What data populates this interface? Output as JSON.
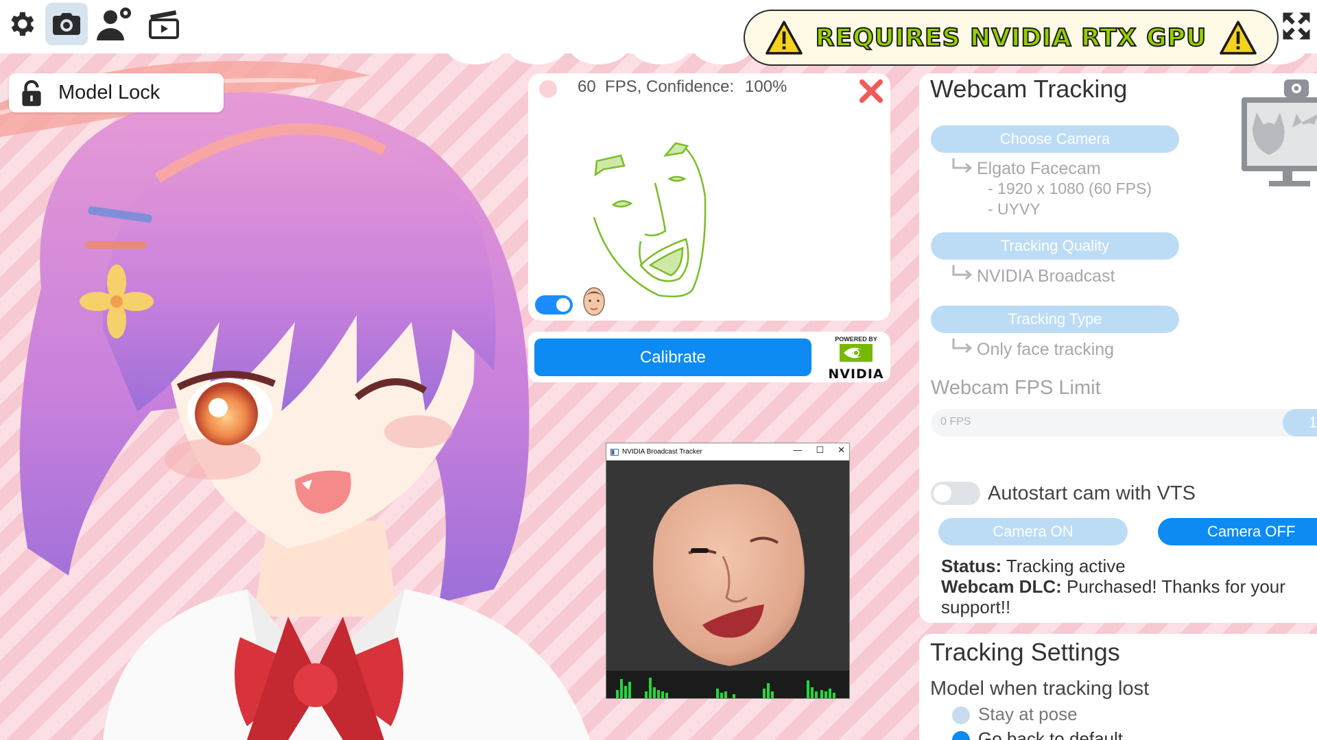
{
  "toolbar": {
    "items": [
      {
        "icon": "gear-icon"
      },
      {
        "icon": "camera-icon",
        "active": true
      },
      {
        "icon": "user-settings-icon"
      },
      {
        "icon": "clapperboard-icon"
      }
    ]
  },
  "banner": {
    "text": "REQUIRES NVIDIA RTX GPU",
    "icon": "warning-icon",
    "text_color": "#95d000",
    "icon_color": "#f5d21b"
  },
  "model_lock": {
    "label": "Model Lock",
    "icon": "lock-icon"
  },
  "face_preview": {
    "fps_text": "60  FPS, Confidence:",
    "confidence": "100%",
    "line_color": "#7cbe2c",
    "toggle_on": true
  },
  "calibrate": {
    "label": "Calibrate",
    "powered_by": "POWERED BY",
    "brand": "NVIDIA"
  },
  "tracker_window": {
    "title": "NVIDIA Broadcast Tracker"
  },
  "webcam": {
    "title": "Webcam Tracking",
    "choose_camera_label": "Choose Camera",
    "camera_name": "Elgato Facecam",
    "camera_resolution": "- 1920 x 1080 (60 FPS)",
    "camera_format": "- UYVY",
    "tracking_quality_label": "Tracking Quality",
    "tracking_quality_value": "NVIDIA Broadcast",
    "tracking_type_label": "Tracking Type",
    "tracking_type_value": "Only face tracking",
    "fps_limit_label": "Webcam FPS Limit",
    "fps_min_label": "0 FPS",
    "fps_value_partial": "1",
    "autostart_label": "Autostart cam with VTS",
    "autostart_on": false,
    "camera_on_label": "Camera ON",
    "camera_off_label": "Camera OFF",
    "status_label": "Status:",
    "status_value": "Tracking active",
    "dlc_label": "Webcam DLC:",
    "dlc_value": "Purchased! Thanks for your support!!",
    "accent_color": "#0d8bf2",
    "inactive_color": "#bcdcf6"
  },
  "tracking_settings": {
    "title": "Tracking Settings",
    "lost_label": "Model when tracking lost",
    "options": [
      {
        "label": "Stay at pose",
        "selected": false
      },
      {
        "label": "Go back to default",
        "selected": true
      }
    ]
  }
}
